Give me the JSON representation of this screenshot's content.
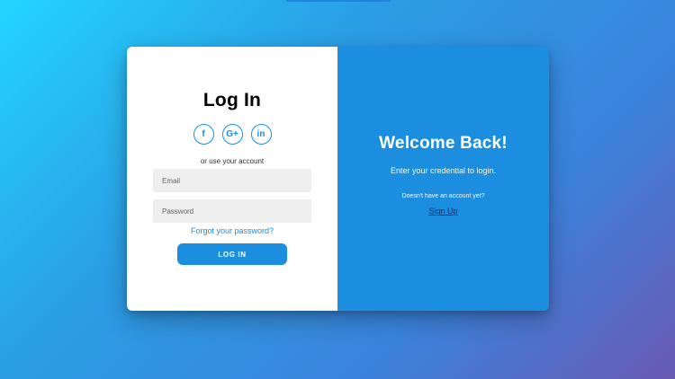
{
  "left": {
    "title": "Log In",
    "social": [
      {
        "icon": "facebook-icon",
        "glyph": "f"
      },
      {
        "icon": "google-plus-icon",
        "glyph": "G+"
      },
      {
        "icon": "linkedin-icon",
        "glyph": "in"
      }
    ],
    "alt_text": "or use your account",
    "email_placeholder": "Email",
    "password_placeholder": "Password",
    "forgot": "Forgot your password?",
    "login_button": "LOG IN"
  },
  "right": {
    "title": "Welcome Back!",
    "subtitle": "Enter your credential to login.",
    "no_account": "Doesn't have an account yet?",
    "signup": "Sign Up"
  },
  "colors": {
    "accent": "#1b8ee0",
    "bg_start": "#23d5ff",
    "bg_end": "#6a5ab3"
  }
}
